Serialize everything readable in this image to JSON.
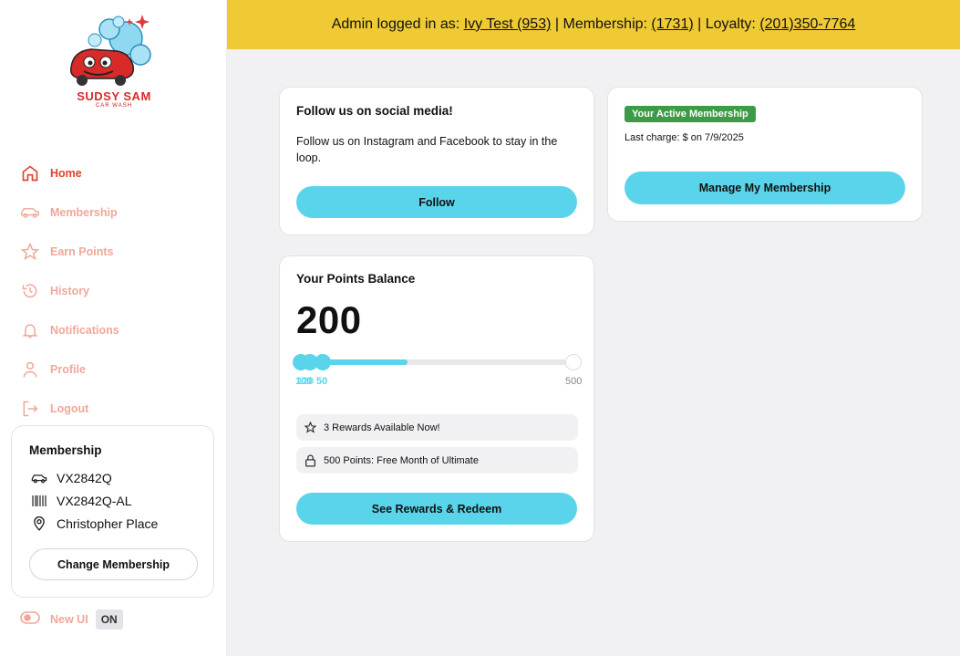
{
  "brand": {
    "name": "SUDSY SAM",
    "tagline": "CAR WASH"
  },
  "header": {
    "prefix": "Admin logged in as:",
    "user": "Ivy Test (953)",
    "membership_label": "| Membership:",
    "membership_id": "(1731)",
    "loyalty_label": "| Loyalty:",
    "loyalty_phone": "(201)350-7764"
  },
  "nav": {
    "items": [
      {
        "label": "Home",
        "icon": "home-icon"
      },
      {
        "label": "Membership",
        "icon": "car-icon"
      },
      {
        "label": "Earn Points",
        "icon": "star-icon"
      },
      {
        "label": "History",
        "icon": "history-icon"
      },
      {
        "label": "Notifications",
        "icon": "bell-icon"
      },
      {
        "label": "Profile",
        "icon": "user-icon"
      },
      {
        "label": "Logout",
        "icon": "logout-icon"
      }
    ]
  },
  "membership_card": {
    "title": "Membership",
    "plate": "VX2842Q",
    "barcode": "VX2842Q-AL",
    "location": "Christopher Place",
    "change_label": "Change Membership"
  },
  "toggle": {
    "label": "New UI",
    "state": "ON"
  },
  "social": {
    "title": "Follow us on social media!",
    "text": "Follow us on Instagram and Facebook to stay in the loop.",
    "button": "Follow"
  },
  "active_membership": {
    "badge": "Your Active Membership",
    "last_charge": "Last charge: $ on 7/9/2025",
    "button": "Manage My Membership"
  },
  "points": {
    "title": "Your Points Balance",
    "balance": "200",
    "progress_fraction": 0.4,
    "tick_overlap_a": "100",
    "tick_overlap_b": "120",
    "tick_mid": "50",
    "tick_end": "500",
    "reward_available": "3 Rewards Available Now!",
    "reward_locked": "500 Points: Free Month of Ultimate",
    "button": "See Rewards & Redeem"
  },
  "colors": {
    "accent": "#5ad4ea",
    "header_bg": "#f0ca34",
    "nav_active": "#e0442c",
    "nav_inactive": "#f0a79a",
    "badge_green": "#3d9a47"
  }
}
